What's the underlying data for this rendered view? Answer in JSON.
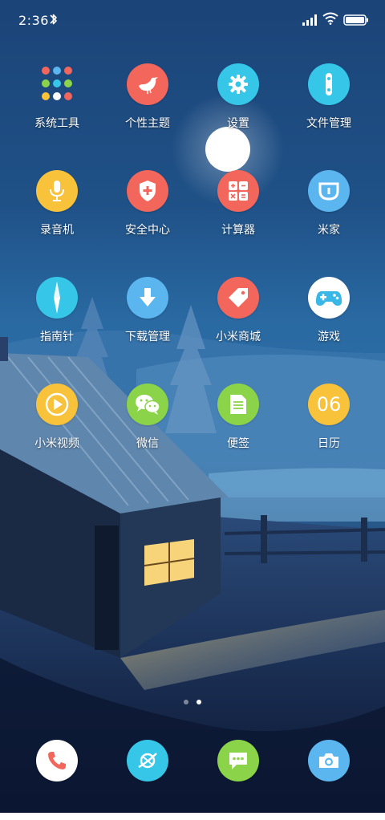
{
  "status_bar": {
    "time": "2:36",
    "icons": [
      "bluetooth-icon",
      "signal-icon",
      "wifi-icon",
      "battery-icon"
    ]
  },
  "apps": [
    {
      "label": "系统工具",
      "icon": "folder-icon",
      "color": "#1f4f86"
    },
    {
      "label": "个性主题",
      "icon": "bird-icon",
      "color": "#f2665c"
    },
    {
      "label": "设置",
      "icon": "gear-icon",
      "color": "#35c6e8"
    },
    {
      "label": "文件管理",
      "icon": "file-manager-icon",
      "color": "#35c6e8"
    },
    {
      "label": "录音机",
      "icon": "microphone-icon",
      "color": "#f8c23a"
    },
    {
      "label": "安全中心",
      "icon": "shield-icon",
      "color": "#f2665c"
    },
    {
      "label": "计算器",
      "icon": "calculator-icon",
      "color": "#f2665c"
    },
    {
      "label": "米家",
      "icon": "mijia-icon",
      "color": "#5bb6f0"
    },
    {
      "label": "指南针",
      "icon": "compass-icon",
      "color": "#35c6e8"
    },
    {
      "label": "下载管理",
      "icon": "download-icon",
      "color": "#5bb6f0"
    },
    {
      "label": "小米商城",
      "icon": "tag-icon",
      "color": "#f2665c"
    },
    {
      "label": "游戏",
      "icon": "gamepad-icon",
      "color": "#ffffff"
    },
    {
      "label": "小米视频",
      "icon": "play-icon",
      "color": "#f8c23a"
    },
    {
      "label": "微信",
      "icon": "wechat-icon",
      "color": "#8bd44a"
    },
    {
      "label": "便签",
      "icon": "notes-icon",
      "color": "#8bd44a"
    },
    {
      "label": "日历",
      "icon": "calendar-icon",
      "color": "#f8c23a",
      "text": "06"
    }
  ],
  "page_indicator": {
    "count": 2,
    "current": 2
  },
  "dock": [
    {
      "label": "",
      "icon": "phone-icon",
      "color": "#ffffff"
    },
    {
      "label": "",
      "icon": "browser-icon",
      "color": "#35c6e8"
    },
    {
      "label": "",
      "icon": "messages-icon",
      "color": "#8bd44a"
    },
    {
      "label": "",
      "icon": "camera-icon",
      "color": "#5bb6f0"
    }
  ]
}
